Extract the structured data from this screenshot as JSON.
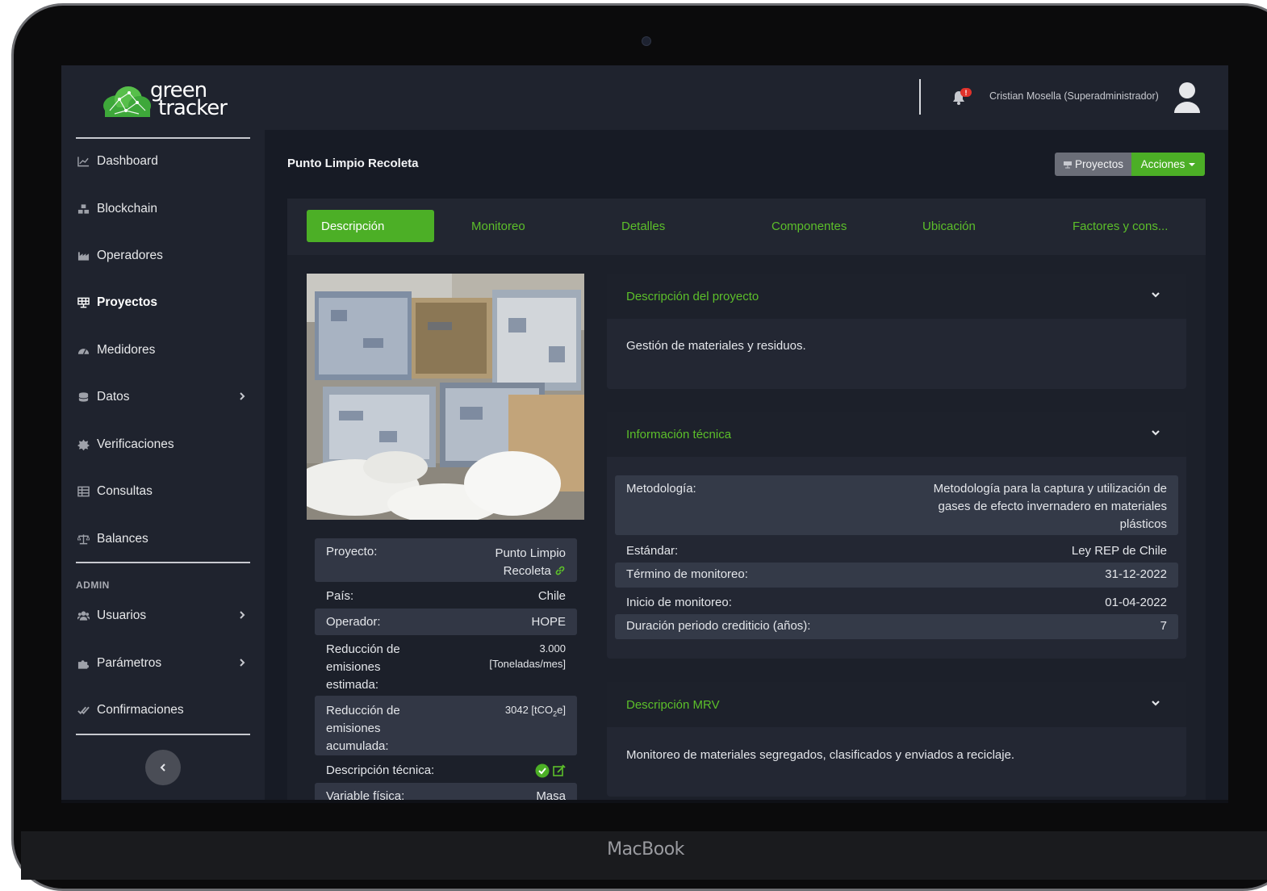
{
  "device": {
    "label": "MacBook"
  },
  "sidebar": {
    "logo": {
      "line1": "green",
      "line2": "tracker"
    },
    "items": [
      {
        "label": "Dashboard",
        "icon": "chart-line-icon"
      },
      {
        "label": "Blockchain",
        "icon": "cubes-icon"
      },
      {
        "label": "Operadores",
        "icon": "industry-icon"
      },
      {
        "label": "Proyectos",
        "icon": "solar-panel-icon",
        "active": true
      },
      {
        "label": "Medidores",
        "icon": "gauge-icon"
      },
      {
        "label": "Datos",
        "icon": "database-icon",
        "has_submenu": true
      },
      {
        "label": "Verificaciones",
        "icon": "certificate-icon"
      },
      {
        "label": "Consultas",
        "icon": "table-icon"
      },
      {
        "label": "Balances",
        "icon": "scale-icon"
      }
    ],
    "admin_label": "ADMIN",
    "admin_items": [
      {
        "label": "Usuarios",
        "icon": "users-icon",
        "has_submenu": true
      },
      {
        "label": "Parámetros",
        "icon": "puzzle-icon",
        "has_submenu": true
      },
      {
        "label": "Confirmaciones",
        "icon": "check-double-icon"
      }
    ]
  },
  "topbar": {
    "notification_badge": "!",
    "user_name": "Cristian Mosella (Superadministrador)"
  },
  "page": {
    "title": "Punto Limpio Recoleta",
    "btn_proyectos": "Proyectos",
    "btn_acciones": "Acciones"
  },
  "tabs": [
    {
      "label": "Descripción",
      "active": true
    },
    {
      "label": "Monitoreo"
    },
    {
      "label": "Detalles"
    },
    {
      "label": "Componentes"
    },
    {
      "label": "Ubicación"
    },
    {
      "label": "Factores y cons..."
    }
  ],
  "project_info": {
    "proyecto_label": "Proyecto:",
    "proyecto_value_line1": "Punto Limpio",
    "proyecto_value_line2": "Recoleta",
    "pais_label": "País:",
    "pais_value": "Chile",
    "operador_label": "Operador:",
    "operador_value": "HOPE",
    "red_est_label_1": "Reducción de",
    "red_est_label_2": "emisiones",
    "red_est_label_3": "estimada:",
    "red_est_value": "3.000",
    "red_est_unit": "[Toneladas/mes]",
    "red_acum_label_1": "Reducción de",
    "red_acum_label_2": "emisiones",
    "red_acum_label_3": "acumulada:",
    "red_acum_value_pre": "3042 [tCO",
    "red_acum_value_sub": "2",
    "red_acum_value_post": "e]",
    "desc_tec_label": "Descripción técnica:",
    "var_fisica_label": "Variable física:",
    "var_fisica_value": "Masa"
  },
  "panels": {
    "descripcion": {
      "title": "Descripción del proyecto",
      "text": "Gestión de materiales y residuos."
    },
    "tecnica": {
      "title": "Información técnica",
      "metodologia_label": "Metodología:",
      "metodologia_value_1": "Metodología para la captura y utilización de",
      "metodologia_value_2": "gases de efecto invernadero en materiales",
      "metodologia_value_3": "plásticos",
      "estandar_label": "Estándar:",
      "estandar_value": "Ley REP de Chile",
      "termino_label": "Término de monitoreo:",
      "termino_value": "31-12-2022",
      "inicio_label": "Inicio de monitoreo:",
      "inicio_value": "01-04-2022",
      "duracion_label": "Duración periodo crediticio (años):",
      "duracion_value": "7"
    },
    "mrv": {
      "title": "Descripción MRV",
      "text": "Monitoreo de materiales segregados, clasificados y enviados a reciclaje."
    }
  },
  "colors": {
    "accent": "#4caf26",
    "accent_text": "#5cbf2a",
    "sidebar_bg": "#1f232e",
    "content_bg": "#171b25"
  }
}
